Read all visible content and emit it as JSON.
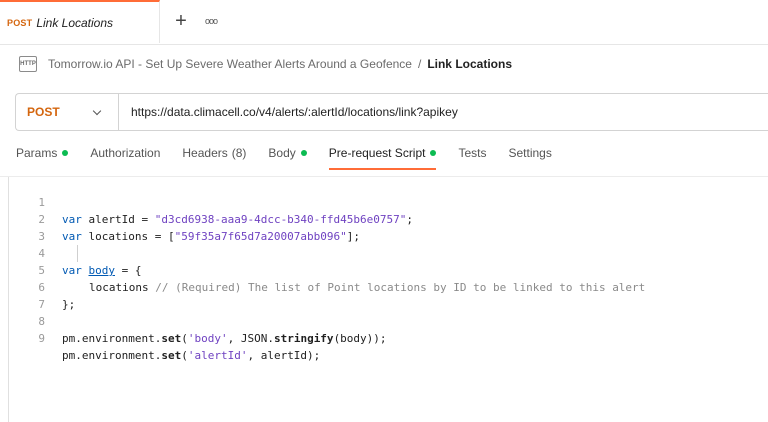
{
  "tab": {
    "method": "POST",
    "title": "Link Locations",
    "add_icon": "+",
    "more_icon": "ooo"
  },
  "breadcrumb": {
    "icon_text": "HTTP",
    "parent": "Tomorrow.io API - Set Up Severe Weather Alerts Around a Geofence",
    "separator": "/",
    "current": "Link Locations"
  },
  "request": {
    "method": "POST",
    "url": "https://data.climacell.co/v4/alerts/:alertId/locations/link?apikey"
  },
  "request_tabs": [
    {
      "label": "Params",
      "dot": true
    },
    {
      "label": "Authorization"
    },
    {
      "label": "Headers",
      "count": "(8)"
    },
    {
      "label": "Body",
      "dot": true
    },
    {
      "label": "Pre-request Script",
      "dot": true,
      "active": true
    },
    {
      "label": "Tests"
    },
    {
      "label": "Settings"
    }
  ],
  "editor": {
    "line_numbers": [
      "1",
      "2",
      "3",
      "4",
      "5",
      "6",
      "7",
      "8",
      "9"
    ],
    "line1": {
      "kw": "var",
      "name": " alertId = ",
      "value": "\"d3cd6938-aaa9-4dcc-b340-ffd45b6e0757\"",
      "end": ";"
    },
    "line2": {
      "kw": "var",
      "name": " locations = [",
      "value": "\"59f35a7f65d7a20007abb096\"",
      "end": "];"
    },
    "line4": {
      "kw": "var",
      "name": "body",
      "end": " = {"
    },
    "line5": {
      "key": "locations",
      "comment": " // (Required) The list of Point locations by ID to be linked to this alert"
    },
    "line6": "};",
    "line8": {
      "a": "pm.environment.",
      "fn": "set",
      "b": "(",
      "str": "'body'",
      "c": ", JSON.",
      "fn2": "stringify",
      "d": "(body));"
    },
    "line9": {
      "a": "pm.environment.",
      "fn": "set",
      "b": "(",
      "str": "'alertId'",
      "c": ", alertId);"
    }
  },
  "colors": {
    "accent": "#ff6c37",
    "method": "#d4660f",
    "status_dot": "#0cbb52"
  }
}
